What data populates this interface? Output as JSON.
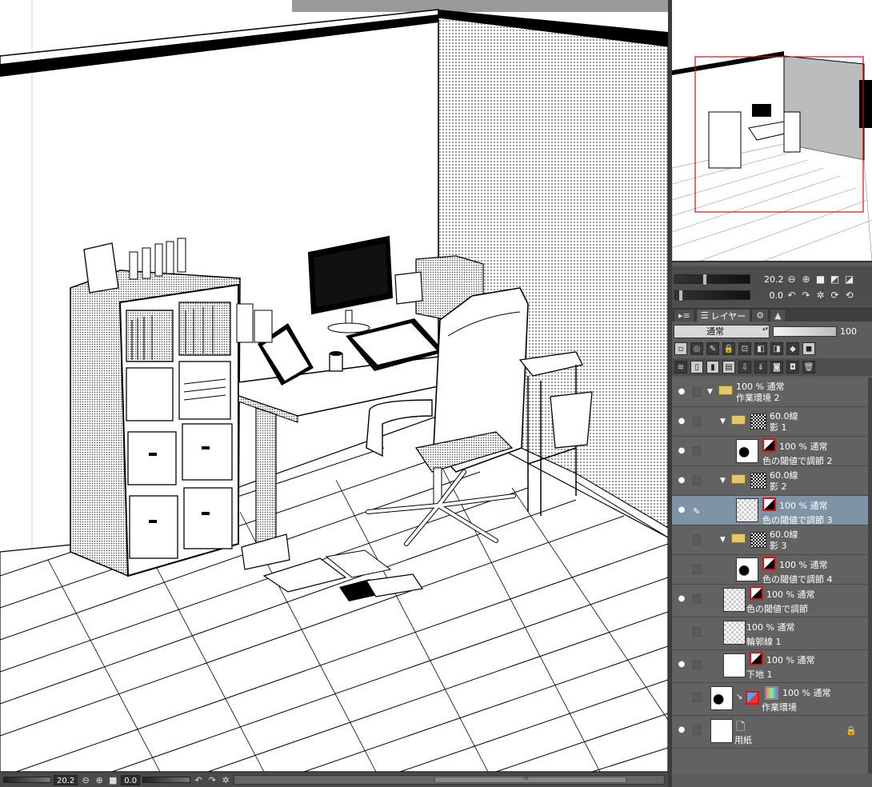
{
  "status_bar": {
    "zoom": "20.2",
    "rotation": "0.0",
    "scroll_marker": "III"
  },
  "navigator": {
    "zoom": "20.2",
    "rotation": "0.0"
  },
  "tabs": [
    {
      "label": "",
      "icon": "menu-icon"
    },
    {
      "label": "レイヤー",
      "icon": "layers-icon"
    },
    {
      "label": "",
      "icon": "layer-property-icon"
    },
    {
      "label": "",
      "icon": "search-layer-icon"
    }
  ],
  "blend_mode": "通常",
  "opacity_value": "100",
  "layers": [
    {
      "mode": "100 % 通常",
      "name": "作業環境 2"
    },
    {
      "mode": "60.0線",
      "name": "影 1"
    },
    {
      "mode": "100 % 通常",
      "name": "色の閾値で調節 2"
    },
    {
      "mode": "60.0線",
      "name": "影 2"
    },
    {
      "mode": "100 % 通常",
      "name": "色の閾値で調節 3"
    },
    {
      "mode": "60.0線",
      "name": "影 3"
    },
    {
      "mode": "100 % 通常",
      "name": "色の閾値で調節 4"
    },
    {
      "mode": "100 % 通常",
      "name": "色の閾値で調節"
    },
    {
      "mode": "100 % 通常",
      "name": "輪郭線 1"
    },
    {
      "mode": "100 % 通常",
      "name": "下地 1"
    },
    {
      "mode": "100 % 通常",
      "name": "作業環境"
    },
    {
      "mode": "",
      "name": "用紙"
    }
  ],
  "colors": {
    "selected_layer": "#7e93a6",
    "panel_bg": "#626262",
    "nav_frame": "#d11111"
  }
}
